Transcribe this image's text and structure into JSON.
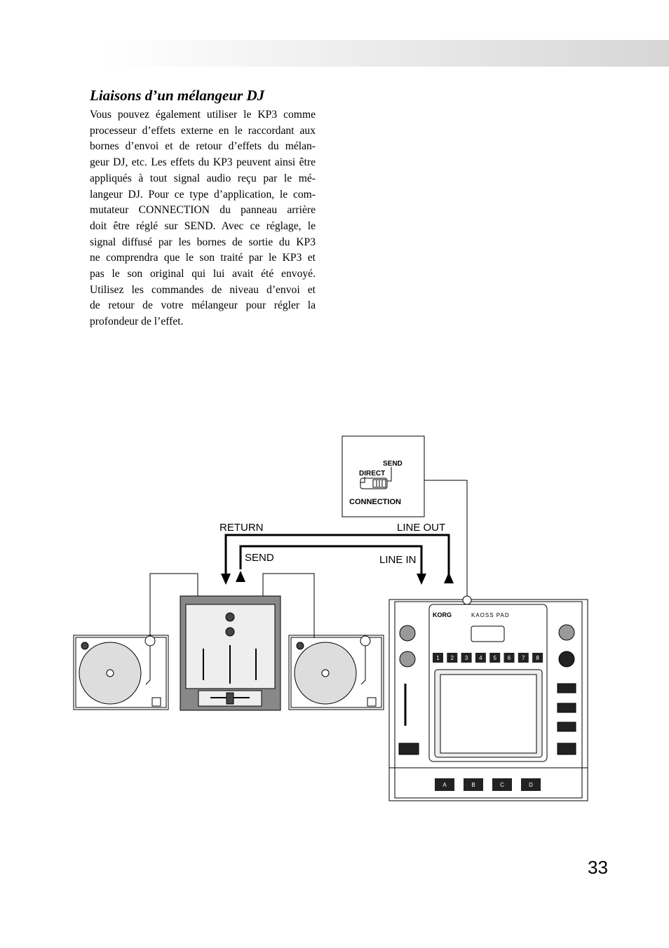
{
  "section_title": "Liaisons d’un mélangeur DJ",
  "body_lines": [
    "Vous pouvez également utiliser le KP3 comme",
    "processeur d’effets externe en le raccordant aux",
    "bornes d’envoi et de retour d’effets du mélan-",
    "geur DJ, etc. Les effets du KP3 peuvent ainsi être",
    "appliqués à tout signal audio reçu par le mé-",
    "langeur DJ. Pour ce type d’application, le com-",
    "mutateur CONNECTION du panneau arrière",
    "doit être réglé sur SEND. Avec ce réglage, le",
    "signal diffusé par les bornes de sortie du KP3",
    "ne comprendra que le son traité par le KP3 et",
    "pas le son original qui lui avait été envoyé.",
    "Utilisez les commandes de niveau d’envoi et",
    "de retour de votre mélangeur pour régler la",
    "profondeur de l’effet."
  ],
  "diagram": {
    "switch": {
      "send": "SEND",
      "direct": "DIRECT",
      "name": "CONNECTION"
    },
    "labels": {
      "return": "RETURN",
      "line_out": "LINE OUT",
      "send": "SEND",
      "line_in": "LINE IN"
    },
    "device_logo": "KORG",
    "device_name": "KAOSS PAD",
    "pad_buttons": [
      "1",
      "2",
      "3",
      "4",
      "5",
      "6",
      "7",
      "8"
    ],
    "sample_buttons": [
      "A",
      "B",
      "C",
      "D"
    ]
  },
  "page_number": "33"
}
